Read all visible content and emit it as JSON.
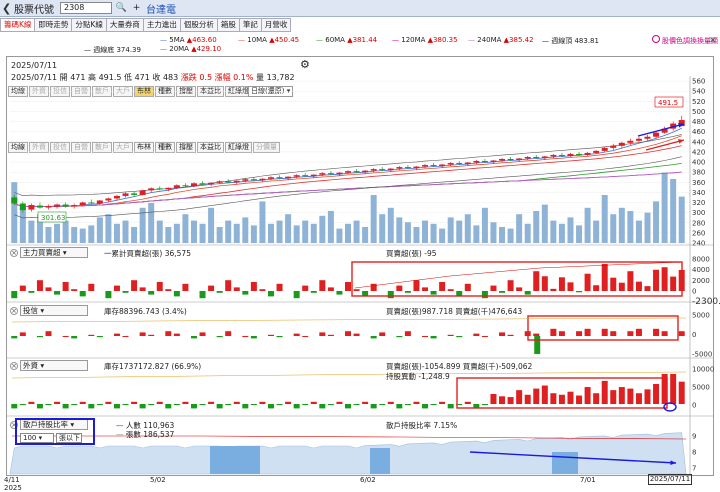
{
  "window": {
    "title": "股票代號",
    "code": "2308",
    "stock_name": "台達電"
  },
  "tabs": [
    "籌碼K線",
    "即時走勢",
    "分點K線",
    "大量券商",
    "主力進出",
    "個股分析",
    "箱股",
    "筆記",
    "月營收"
  ],
  "ma_legend": [
    {
      "label": "5MA",
      "value": "▲463.60",
      "color": "#3b6ee0"
    },
    {
      "label": "10MA",
      "value": "▲450.45",
      "color": "#e05030"
    },
    {
      "label": "60MA",
      "value": "▲381.44",
      "color": "#2a9a2a"
    },
    {
      "label": "120MA",
      "value": "▲380.35",
      "color": "#d00080"
    },
    {
      "label": "240MA",
      "value": "▲385.42",
      "color": "#b070d0"
    },
    {
      "label": "週線頂",
      "value": "483.81",
      "color": "#333333"
    },
    {
      "label": "週線底",
      "value": "374.39",
      "color": "#333333"
    },
    {
      "label": "20MA",
      "value": "▲429.10",
      "color": "#e03030"
    }
  ],
  "hint": "股價色調換換量顯",
  "price_info": {
    "date": "2025/07/11",
    "open_label": "開",
    "open": "471",
    "high_label": "高",
    "high": "491.5",
    "low_label": "低",
    "low": "471",
    "close_label": "收",
    "close": "483",
    "change_label": "漲跌",
    "change": "0.5",
    "pct_label": "漲幅",
    "pct": "0.1%",
    "vol_label": "量",
    "vol": "13,782"
  },
  "indicator_tabs": [
    {
      "label": "均線",
      "state": "normal"
    },
    {
      "label": "外資",
      "state": "dis"
    },
    {
      "label": "投信",
      "state": "dis"
    },
    {
      "label": "自營",
      "state": "dis"
    },
    {
      "label": "散戶",
      "state": "dis"
    },
    {
      "label": "大戶",
      "state": "dis"
    },
    {
      "label": "布林",
      "state": "on"
    },
    {
      "label": "種數",
      "state": "normal"
    },
    {
      "label": "撐壓",
      "state": "normal"
    },
    {
      "label": "本益比",
      "state": "normal"
    },
    {
      "label": "紅綠燈",
      "state": "normal"
    },
    {
      "label": "分價量",
      "state": "dis"
    }
  ],
  "period_select": "日線(還原)",
  "indicator_tabs2": [
    {
      "label": "均線",
      "state": "normal"
    },
    {
      "label": "外資",
      "state": "dis"
    },
    {
      "label": "投信",
      "state": "dis"
    },
    {
      "label": "自營",
      "state": "dis"
    },
    {
      "label": "散戶",
      "state": "dis"
    },
    {
      "label": "大戶",
      "state": "dis"
    },
    {
      "label": "布林",
      "state": "normal"
    },
    {
      "label": "種數",
      "state": "normal"
    },
    {
      "label": "撐壓",
      "state": "normal"
    },
    {
      "label": "本益比",
      "state": "normal"
    },
    {
      "label": "紅綠燈",
      "state": "normal"
    },
    {
      "label": "分價量",
      "state": "dis"
    }
  ],
  "price_axis": [
    "560",
    "540",
    "520",
    "500",
    "480",
    "460",
    "440",
    "420",
    "400",
    "380",
    "360",
    "340",
    "320",
    "300",
    "280",
    "260",
    "240"
  ],
  "price_tag": "491.5",
  "low_tag": "301.63",
  "panels": [
    {
      "select": "主力買賣超",
      "left_text": "一累計買賣超(張) 36,575",
      "right_text": "買賣超(張) -95",
      "axis": [
        "8000",
        "4000",
        "2000",
        "0"
      ],
      "extra": "-2300."
    },
    {
      "select": "投信",
      "left_text": "庫存88396.743 (3.4%)",
      "right_text": "買賣超(張)987.718 買賣超(千)476,643",
      "axis": [
        "5000",
        "0",
        "-5000"
      ],
      "extra": ""
    },
    {
      "select": "外資",
      "left_text": "庫存1737172.827 (66.9%)",
      "right_text": "買賣超(張)-1054.899 買賣超(千)-509,062",
      "right_text2": "持股異動 -1,248.9",
      "axis": [
        "10000",
        "5000",
        "0"
      ],
      "extra": ""
    },
    {
      "select": "散戶持股比率",
      "left_text": "人數 110,963",
      "left_text2": "張數 186,537",
      "right_text": "散戶持股比率 7.15%",
      "axis": [
        "9",
        "8",
        "7"
      ],
      "extra": ""
    }
  ],
  "retail_filter": {
    "value": "100",
    "unit": "張以下"
  },
  "dates": [
    "4/11",
    "5/02",
    "6/02",
    "7/01"
  ],
  "year": "2025",
  "cursor_date": "2025/07/11",
  "colors": {
    "up": "#e02020",
    "down": "#1a9a1a",
    "volume": "#8fb3d6",
    "annotation_red": "#e02020",
    "annotation_blue": "#1a1ae0"
  },
  "chart_data": {
    "type": "candlestick",
    "ohlc": [
      [
        330,
        335,
        315,
        318
      ],
      [
        318,
        322,
        300,
        305
      ],
      [
        306,
        318,
        302,
        315
      ],
      [
        314,
        320,
        308,
        310
      ],
      [
        310,
        316,
        306,
        313
      ],
      [
        312,
        318,
        308,
        316
      ],
      [
        316,
        320,
        310,
        312
      ],
      [
        312,
        318,
        308,
        315
      ],
      [
        315,
        322,
        312,
        320
      ],
      [
        320,
        326,
        316,
        318
      ],
      [
        318,
        325,
        316,
        324
      ],
      [
        324,
        330,
        320,
        328
      ],
      [
        328,
        335,
        324,
        333
      ],
      [
        333,
        340,
        330,
        338
      ],
      [
        338,
        342,
        332,
        335
      ],
      [
        335,
        345,
        334,
        344
      ],
      [
        344,
        350,
        340,
        348
      ],
      [
        348,
        352,
        344,
        346
      ],
      [
        346,
        350,
        342,
        349
      ],
      [
        349,
        356,
        346,
        354
      ],
      [
        354,
        358,
        350,
        352
      ],
      [
        352,
        360,
        350,
        358
      ],
      [
        358,
        362,
        354,
        356
      ],
      [
        356,
        360,
        352,
        359
      ],
      [
        359,
        364,
        356,
        362
      ],
      [
        362,
        366,
        358,
        360
      ],
      [
        360,
        364,
        356,
        363
      ],
      [
        363,
        368,
        360,
        366
      ],
      [
        366,
        370,
        362,
        364
      ],
      [
        364,
        368,
        360,
        367
      ],
      [
        367,
        372,
        364,
        370
      ],
      [
        370,
        374,
        366,
        368
      ],
      [
        368,
        372,
        364,
        371
      ],
      [
        371,
        376,
        368,
        374
      ],
      [
        374,
        378,
        370,
        372
      ],
      [
        372,
        376,
        368,
        375
      ],
      [
        375,
        380,
        372,
        378
      ],
      [
        378,
        382,
        374,
        376
      ],
      [
        376,
        380,
        372,
        379
      ],
      [
        379,
        384,
        376,
        382
      ],
      [
        382,
        386,
        378,
        380
      ],
      [
        380,
        384,
        376,
        383
      ],
      [
        383,
        388,
        380,
        386
      ],
      [
        386,
        390,
        382,
        384
      ],
      [
        384,
        388,
        380,
        387
      ],
      [
        387,
        392,
        384,
        390
      ],
      [
        390,
        394,
        386,
        388
      ],
      [
        388,
        392,
        384,
        391
      ],
      [
        391,
        396,
        388,
        394
      ],
      [
        394,
        398,
        390,
        392
      ],
      [
        392,
        396,
        388,
        395
      ],
      [
        395,
        400,
        392,
        398
      ],
      [
        398,
        402,
        394,
        396
      ],
      [
        396,
        400,
        392,
        399
      ],
      [
        399,
        404,
        396,
        402
      ],
      [
        402,
        406,
        398,
        400
      ],
      [
        400,
        404,
        396,
        403
      ],
      [
        403,
        408,
        400,
        406
      ],
      [
        406,
        410,
        402,
        404
      ],
      [
        404,
        408,
        400,
        407
      ],
      [
        407,
        412,
        404,
        410
      ],
      [
        410,
        414,
        406,
        408
      ],
      [
        408,
        412,
        404,
        411
      ],
      [
        411,
        416,
        408,
        414
      ],
      [
        414,
        418,
        410,
        412
      ],
      [
        412,
        418,
        410,
        416
      ],
      [
        416,
        420,
        412,
        414
      ],
      [
        414,
        420,
        412,
        418
      ],
      [
        418,
        424,
        416,
        422
      ],
      [
        422,
        430,
        420,
        428
      ],
      [
        428,
        436,
        424,
        432
      ],
      [
        432,
        440,
        428,
        438
      ],
      [
        438,
        446,
        434,
        442
      ],
      [
        442,
        450,
        438,
        446
      ],
      [
        446,
        454,
        442,
        450
      ],
      [
        450,
        460,
        446,
        458
      ],
      [
        458,
        470,
        456,
        466
      ],
      [
        466,
        480,
        462,
        476
      ],
      [
        471,
        491.5,
        471,
        483
      ]
    ],
    "volume": [
      38,
      22,
      14,
      18,
      10,
      12,
      14,
      10,
      9,
      11,
      16,
      18,
      12,
      14,
      10,
      22,
      25,
      14,
      10,
      12,
      18,
      14,
      12,
      22,
      10,
      14,
      12,
      16,
      11,
      26,
      12,
      14,
      18,
      11,
      14,
      12,
      17,
      20,
      9,
      12,
      14,
      10,
      30,
      18,
      22,
      16,
      13,
      10,
      14,
      12,
      9,
      16,
      14,
      18,
      11,
      22,
      13,
      10,
      9,
      18,
      12,
      20,
      24,
      14,
      12,
      16,
      11,
      22,
      14,
      30,
      18,
      22,
      20,
      14,
      19,
      26,
      44,
      40,
      29
    ],
    "ma_lines": [
      "5MA",
      "10MA",
      "20MA",
      "60MA",
      "120MA",
      "240MA"
    ]
  }
}
